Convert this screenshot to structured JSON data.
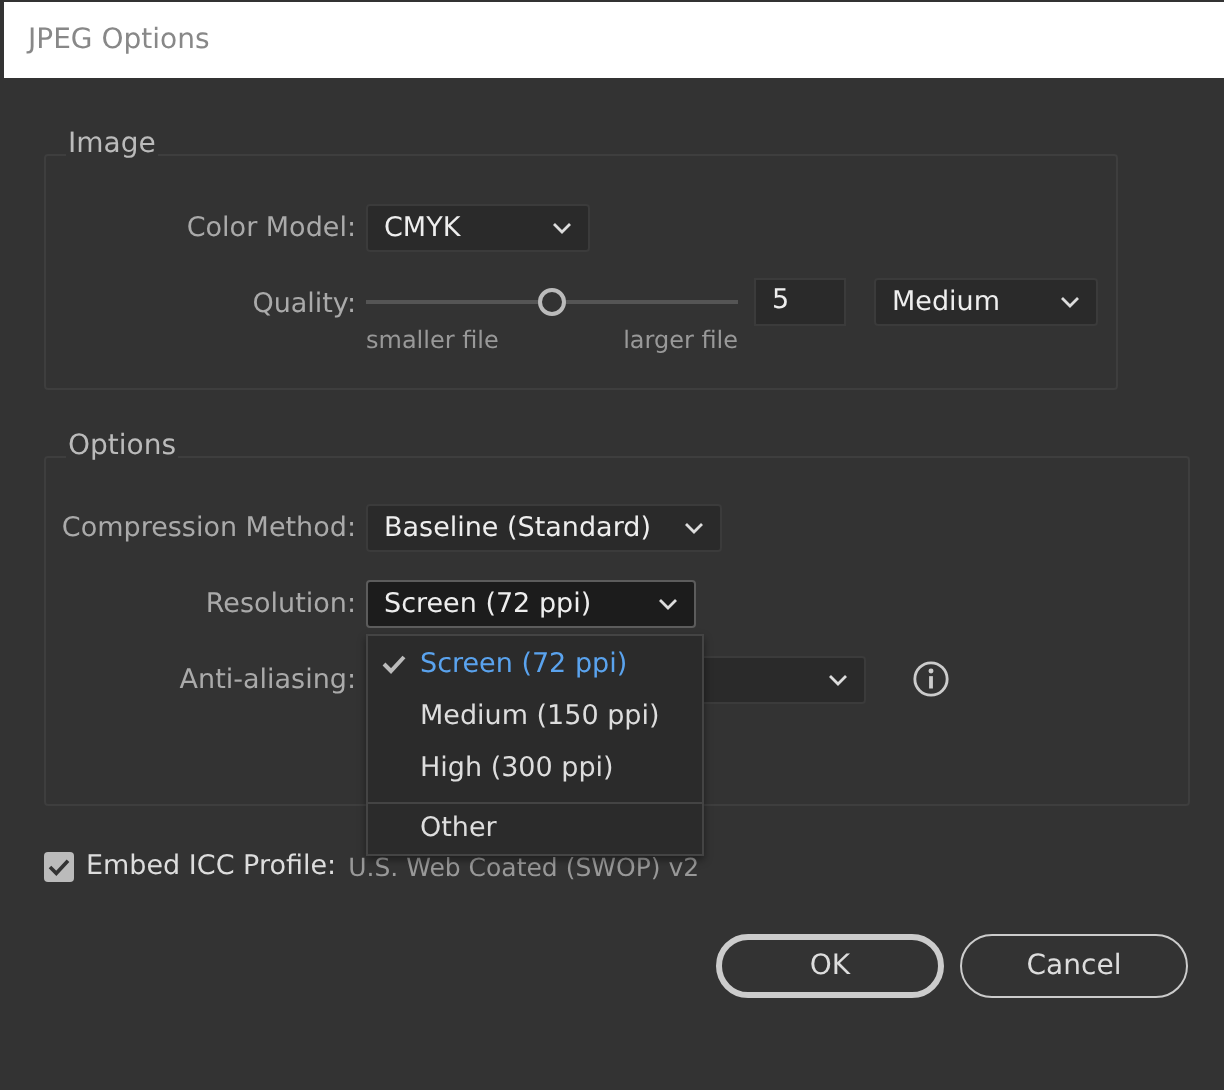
{
  "window": {
    "title": "JPEG Options"
  },
  "image": {
    "title": "Image",
    "color_model": {
      "label": "Color Model:",
      "value": "CMYK"
    },
    "quality": {
      "label": "Quality:",
      "level": 0.5,
      "min_label": "smaller file",
      "max_label": "larger file",
      "value": "5",
      "preset": "Medium"
    }
  },
  "options": {
    "title": "Options",
    "compression": {
      "label": "Compression Method:",
      "value": "Baseline (Standard)"
    },
    "resolution": {
      "label": "Resolution:",
      "value": "Screen (72 ppi)",
      "expanded": true,
      "menu": [
        {
          "label": "Screen (72 ppi)",
          "selected": true,
          "separator_before": false
        },
        {
          "label": "Medium (150 ppi)",
          "selected": false,
          "separator_before": false
        },
        {
          "label": "High (300 ppi)",
          "selected": false,
          "separator_before": false
        },
        {
          "label": "Other",
          "selected": false,
          "separator_before": true
        }
      ]
    },
    "anti_aliasing": {
      "label": "Anti-aliasing:"
    }
  },
  "embed_icc": {
    "label": "Embed ICC Profile:",
    "checked": true,
    "profile": "U.S. Web Coated (SWOP) v2"
  },
  "buttons": [
    {
      "label": "OK",
      "default": true
    },
    {
      "label": "Cancel",
      "default": false
    }
  ]
}
